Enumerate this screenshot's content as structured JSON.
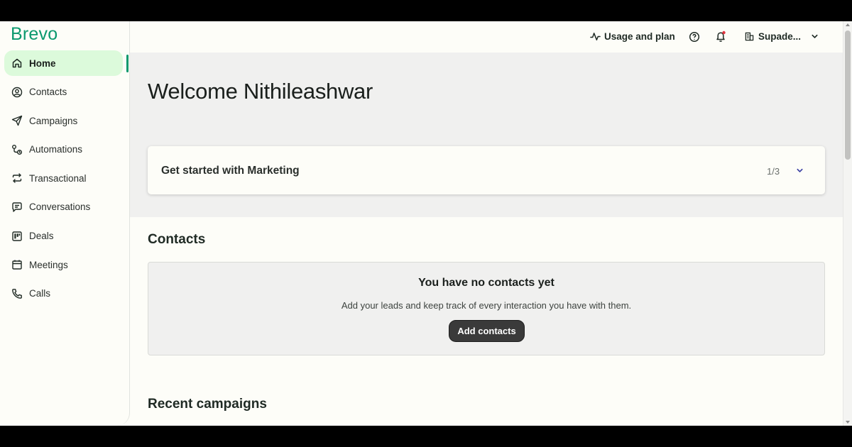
{
  "app": {
    "logo": "Brevo",
    "accent_color": "#0b996e",
    "active_nav_bg": "#dcfadb"
  },
  "sidebar": {
    "items": [
      {
        "label": "Home",
        "icon": "home-icon",
        "active": true
      },
      {
        "label": "Contacts",
        "icon": "contacts-icon",
        "active": false
      },
      {
        "label": "Campaigns",
        "icon": "send-icon",
        "active": false
      },
      {
        "label": "Automations",
        "icon": "automations-icon",
        "active": false
      },
      {
        "label": "Transactional",
        "icon": "arrows-swap-icon",
        "active": false
      },
      {
        "label": "Conversations",
        "icon": "chat-icon",
        "active": false
      },
      {
        "label": "Deals",
        "icon": "kanban-icon",
        "active": false
      },
      {
        "label": "Meetings",
        "icon": "calendar-icon",
        "active": false
      },
      {
        "label": "Calls",
        "icon": "phone-icon",
        "active": false
      }
    ]
  },
  "topbar": {
    "usage_label": "Usage and plan",
    "help_icon": "help-icon",
    "notifications_icon": "bell-icon",
    "notification_dot_color": "#e0343f",
    "org_name": "Supade..."
  },
  "main": {
    "welcome": "Welcome Nithileashwar",
    "get_started": {
      "title": "Get started with Marketing",
      "progress": "1/3"
    },
    "contacts": {
      "title": "Contacts",
      "empty_title": "You have no contacts yet",
      "empty_subtitle": "Add your leads and keep track of every interaction you have with them.",
      "add_button": "Add contacts"
    },
    "recent_campaigns": {
      "title": "Recent campaigns"
    }
  }
}
